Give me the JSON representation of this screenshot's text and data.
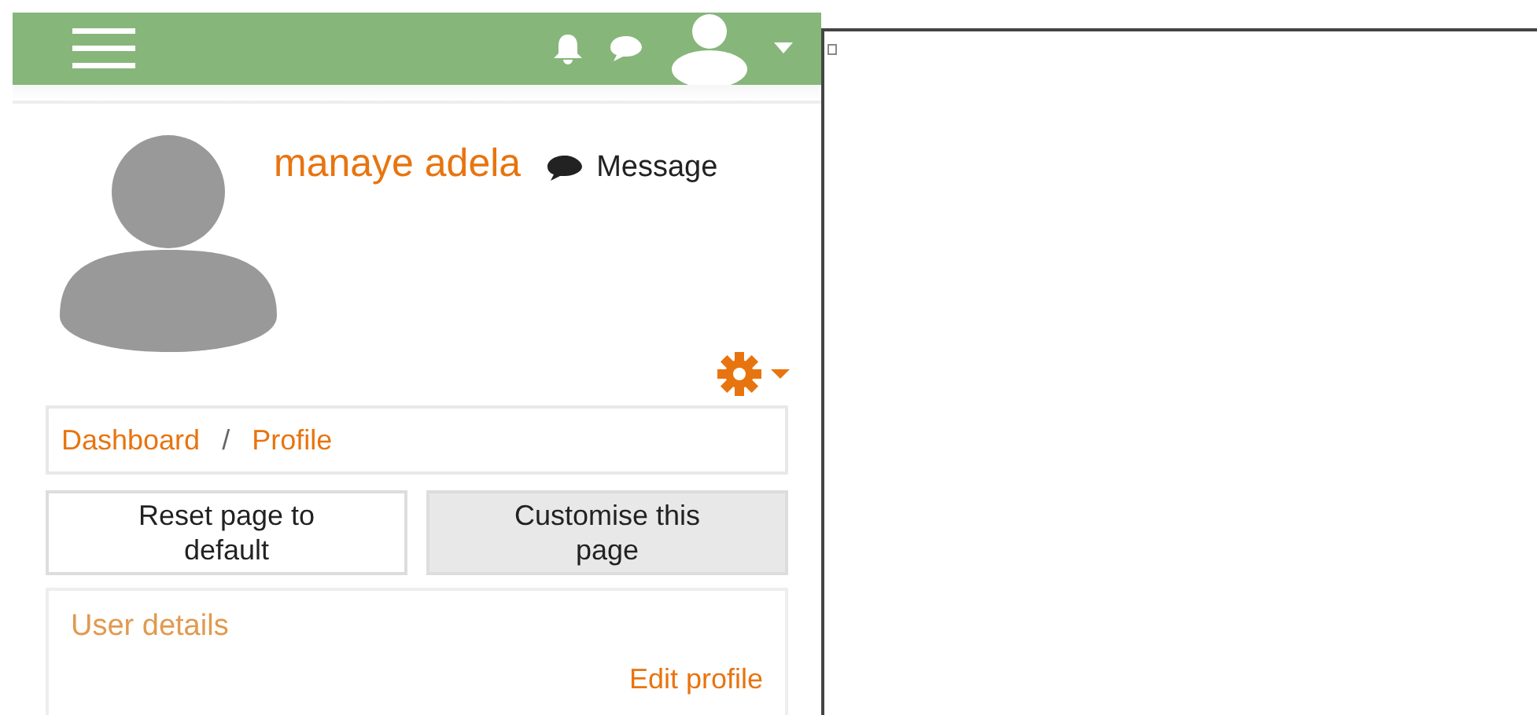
{
  "profile": {
    "name": "manaye adela",
    "message_label": "Message"
  },
  "breadcrumb": [
    "Dashboard",
    "Profile"
  ],
  "breadcrumb_separator": "/",
  "buttons": [
    {
      "label": "Reset page to default",
      "selected": false
    },
    {
      "label": "Customise this page",
      "selected": true
    }
  ],
  "user_details": {
    "title": "User details",
    "edit_link": "Edit profile"
  }
}
